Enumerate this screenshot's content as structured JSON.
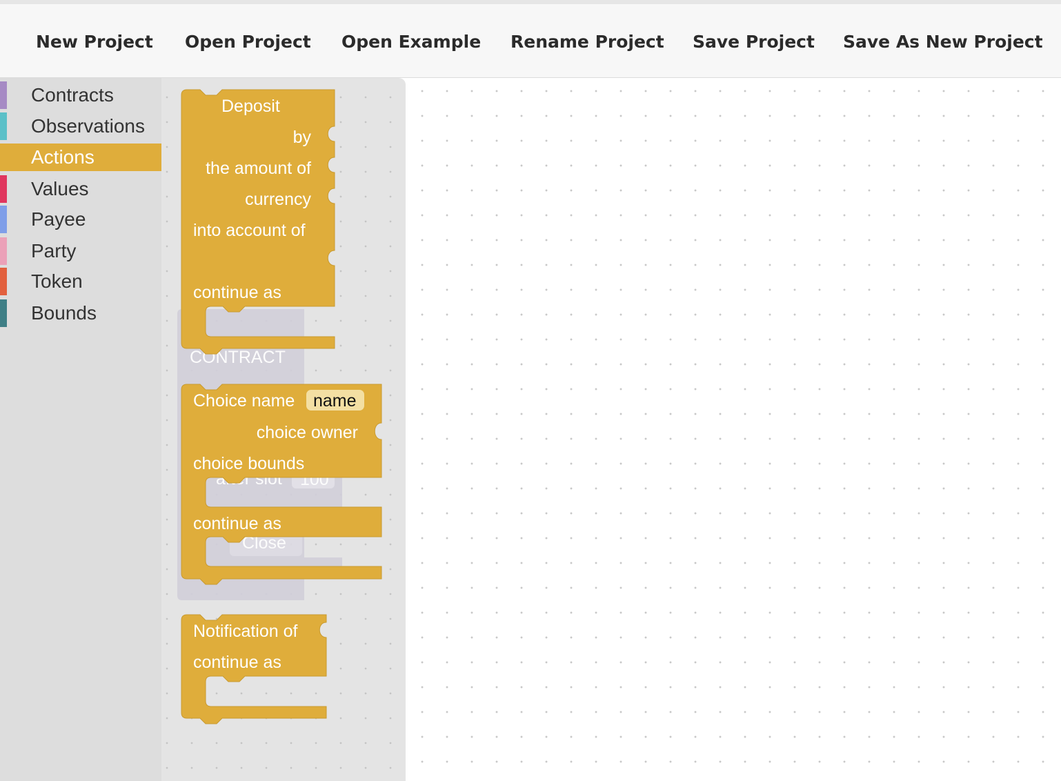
{
  "menu": {
    "new_project": "New Project",
    "open_project": "Open Project",
    "open_example": "Open Example",
    "rename_project": "Rename Project",
    "save_project": "Save Project",
    "save_as_new_project": "Save As New Project"
  },
  "toolbox": {
    "categories": [
      {
        "label": "Contracts",
        "color": "#a68ac4"
      },
      {
        "label": "Observations",
        "color": "#5bc0c8"
      },
      {
        "label": "Actions",
        "color": "#dfad3b",
        "selected": true
      },
      {
        "label": "Values",
        "color": "#e0365e"
      },
      {
        "label": "Payee",
        "color": "#7f9ee8"
      },
      {
        "label": "Party",
        "color": "#eba1b8"
      },
      {
        "label": "Token",
        "color": "#e2603e"
      },
      {
        "label": "Bounds",
        "color": "#3f7f86"
      }
    ]
  },
  "flyout": {
    "block_color": "#dfad3b",
    "ghost_color": "#d2cfda",
    "deposit_block": {
      "title": "Deposit",
      "by": "by",
      "amount": "the amount of",
      "currency": "currency",
      "into": "into account of",
      "continue": "continue as"
    },
    "choice_block": {
      "title": "Choice name",
      "name_field": "name",
      "owner": "choice owner",
      "bounds": "choice bounds",
      "continue": "continue as"
    },
    "notify_block": {
      "title": "Notification of",
      "continue": "continue as"
    },
    "ghost_block": {
      "contract": "CONTRACT",
      "after_slot": "after slot",
      "slot_value": "100",
      "close": "Close"
    }
  }
}
